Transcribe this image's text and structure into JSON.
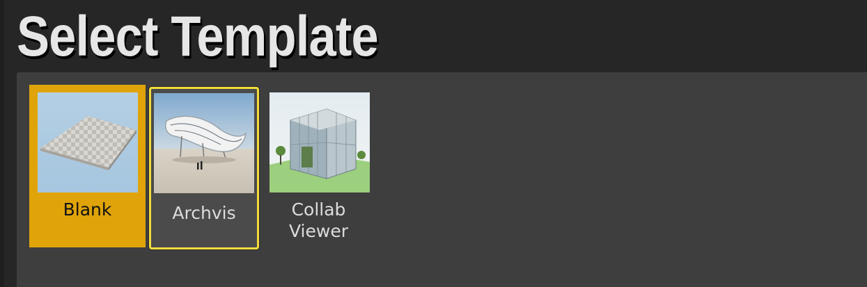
{
  "title": "Select Template",
  "templates": [
    {
      "label": "Blank",
      "state": "selected",
      "thumbnail_icon": "checkerboard-floor-icon"
    },
    {
      "label": "Archvis",
      "state": "hovered",
      "thumbnail_icon": "architecture-render-icon"
    },
    {
      "label": "Collab\nViewer",
      "state": "normal",
      "thumbnail_icon": "glass-building-icon"
    }
  ],
  "colors": {
    "selected_background": "#e0a40a",
    "hover_border": "#f2dd3a",
    "panel_background": "#3e3e3e",
    "window_background": "#262626"
  }
}
